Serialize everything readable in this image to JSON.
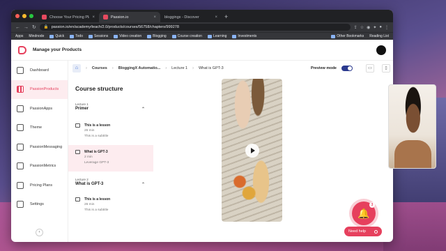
{
  "browser": {
    "tabs": [
      {
        "title": "Choose Your Pricing Plan & Gr...",
        "active": false
      },
      {
        "title": "Passion.io",
        "active": true
      },
      {
        "title": "bloggingx - Discover",
        "active": false
      }
    ],
    "url": "passion.io/en/academy/teach/2.0/products/courses/56758/chapters/999278",
    "bookmarks": [
      "Apps",
      "Mindnode",
      "Quick",
      "Todo",
      "Sessions",
      "Video creation",
      "Blogging",
      "Course creation",
      "Learning",
      "Investments",
      "Other Bookmarks",
      "Reading List"
    ]
  },
  "app": {
    "title": "Manage your Products"
  },
  "sidebar": {
    "items": [
      {
        "label": "Dashboard",
        "icon": "home-icon",
        "active": false
      },
      {
        "label": "PassionProducts",
        "icon": "grid-icon",
        "active": true
      },
      {
        "label": "PassionApps",
        "icon": "phone-icon",
        "active": false
      },
      {
        "label": "Theme",
        "icon": "palette-icon",
        "active": false
      },
      {
        "label": "PassionMessaging",
        "icon": "message-icon",
        "active": false
      },
      {
        "label": "PassionMetrics",
        "icon": "chart-icon",
        "active": false
      },
      {
        "label": "Pricing Plans",
        "icon": "dollar-icon",
        "active": false
      },
      {
        "label": "Settings",
        "icon": "gear-icon",
        "active": false
      }
    ]
  },
  "breadcrumb": {
    "items": [
      "Courses",
      "BloggingX Automatio...",
      "Lecture 1",
      "What is GPT-3"
    ],
    "preview_label": "Preview mode"
  },
  "structure": {
    "title": "Course structure",
    "lectures": [
      {
        "sub": "Lecture 1",
        "name": "Primer",
        "lessons": [
          {
            "title": "This is a lesson",
            "duration": "26 min",
            "subtitle": "This is a subtitle",
            "active": false
          },
          {
            "title": "What is GPT-3",
            "duration": "2 min",
            "subtitle": "Leverage GPT-3",
            "active": true
          }
        ]
      },
      {
        "sub": "Lecture 2",
        "name": "What is GPT-3",
        "lessons": [
          {
            "title": "This is a lesson",
            "duration": "26 min",
            "subtitle": "This is a subtitle",
            "active": false
          }
        ]
      }
    ]
  },
  "help": {
    "label": "Need help",
    "count": "3"
  },
  "colors": {
    "accent": "#e6405d",
    "toggle": "#2b3a8f"
  }
}
